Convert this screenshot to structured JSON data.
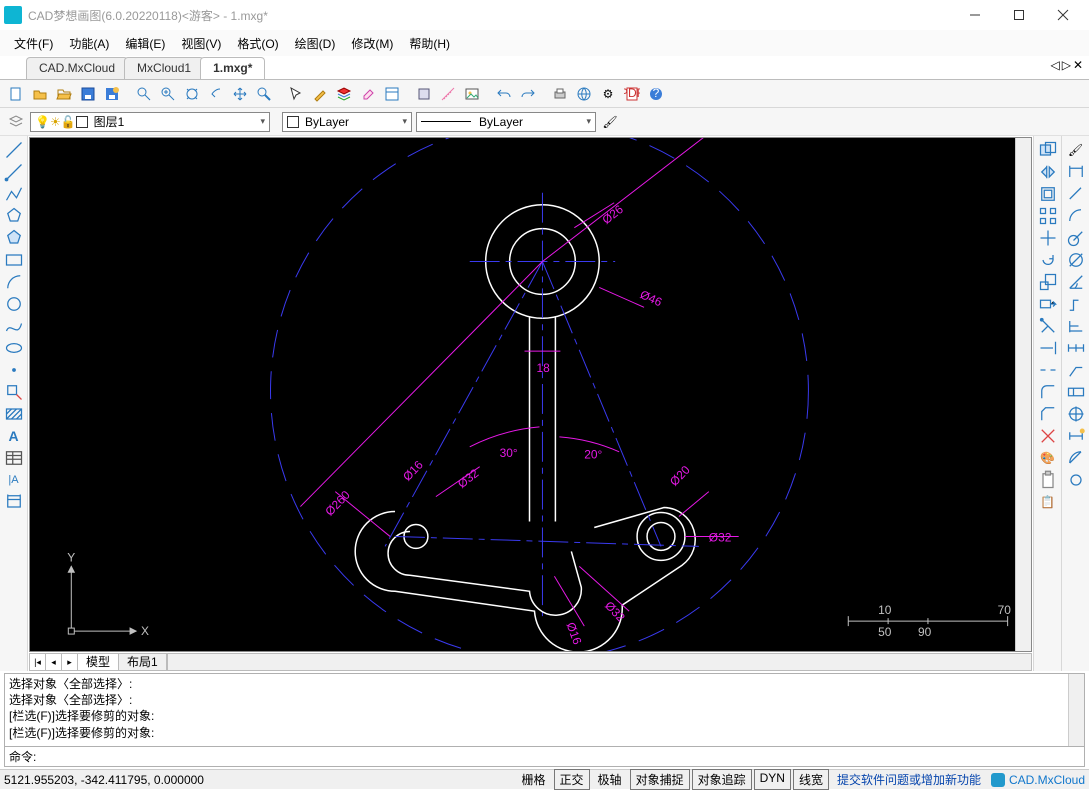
{
  "title": "CAD梦想画图(6.0.20220118)<游客> - 1.mxg*",
  "menu": [
    "文件(F)",
    "功能(A)",
    "编辑(E)",
    "视图(V)",
    "格式(O)",
    "绘图(D)",
    "修改(M)",
    "帮助(H)"
  ],
  "tabs": {
    "items": [
      "CAD.MxCloud",
      "MxCloud1",
      "1.mxg*"
    ],
    "active": 2
  },
  "layer": {
    "current": "图层1",
    "color_label": "ByLayer",
    "linetype_label": "ByLayer"
  },
  "sheet_tabs": {
    "items": [
      "模型",
      "布局1"
    ],
    "active": 0
  },
  "commandlog": [
    "选择对象〈全部选择〉:",
    "选择对象〈全部选择〉:",
    "[栏选(F)]选择要修剪的对象:",
    "[栏选(F)]选择要修剪的对象:"
  ],
  "command_prompt": "命令:",
  "status": {
    "coords": "5121.955203, -342.411795,  0.000000",
    "toggles": [
      "栅格",
      "正交",
      "极轴",
      "对象捕捉",
      "对象追踪",
      "DYN",
      "线宽"
    ],
    "boxed": [
      1,
      3,
      4,
      5,
      6
    ],
    "feedback_link": "提交软件问题或增加新功能",
    "brand": "CAD.MxCloud"
  },
  "drawing": {
    "dims": {
      "d260": "Ø260",
      "d46": "Ø46",
      "d26": "Ø26",
      "d16a": "Ø16",
      "d16b": "Ø16",
      "d32a": "Ø32",
      "d32b": "Ø32",
      "d32c": "Ø32",
      "d20": "Ø20",
      "len18": "18",
      "ang30": "30°",
      "ang20": "20°"
    },
    "ruler": {
      "v10": "10",
      "v50": "50",
      "v70": "70",
      "v90": "90"
    },
    "axes": {
      "x": "X",
      "y": "Y"
    }
  }
}
